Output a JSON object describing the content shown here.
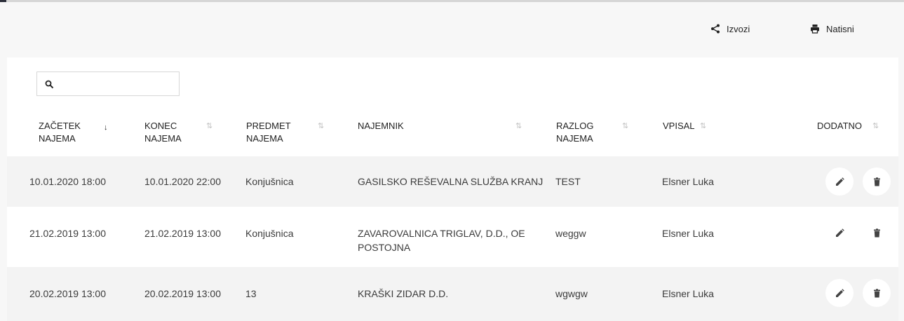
{
  "toolbar": {
    "export_label": "Izvozi",
    "print_label": "Natisni"
  },
  "search": {
    "value": "",
    "placeholder": ""
  },
  "columns": [
    {
      "line1": "Začetek",
      "line2": "najema"
    },
    {
      "line1": "Konec",
      "line2": "najema"
    },
    {
      "line1": "Predmet",
      "line2": "najema"
    },
    {
      "line1": "Najemnik",
      "line2": ""
    },
    {
      "line1": "Razlog",
      "line2": "najema"
    },
    {
      "line1": "Vpisal",
      "line2": ""
    },
    {
      "line1": "Dodatno",
      "line2": ""
    }
  ],
  "rows": [
    {
      "start": "10.01.2020 18:00",
      "end": "10.01.2020 22:00",
      "item": "Konjušnica",
      "tenant": "GASILSKO REŠEVALNA SLUŽBA KRANJ",
      "reason": "TEST",
      "entered_by": "Elsner Luka"
    },
    {
      "start": "21.02.2019 13:00",
      "end": "21.02.2019 13:00",
      "item": "Konjušnica",
      "tenant": "ZAVAROVALNICA TRIGLAV, D.D., OE POSTOJNA",
      "reason": "weggw",
      "entered_by": "Elsner Luka"
    },
    {
      "start": "20.02.2019 13:00",
      "end": "20.02.2019 13:00",
      "item": "13",
      "tenant": "KRAŠKI ZIDAR D.D.",
      "reason": "wgwgw",
      "entered_by": "Elsner Luka"
    }
  ],
  "icons": {
    "export": "share-icon",
    "print": "printer-icon",
    "search": "search-icon",
    "edit": "pencil-icon",
    "delete": "trash-icon"
  },
  "colors": {
    "row_shade": "#f3f3f3",
    "background": "#f7f7f7",
    "text": "#3b3b3b"
  }
}
